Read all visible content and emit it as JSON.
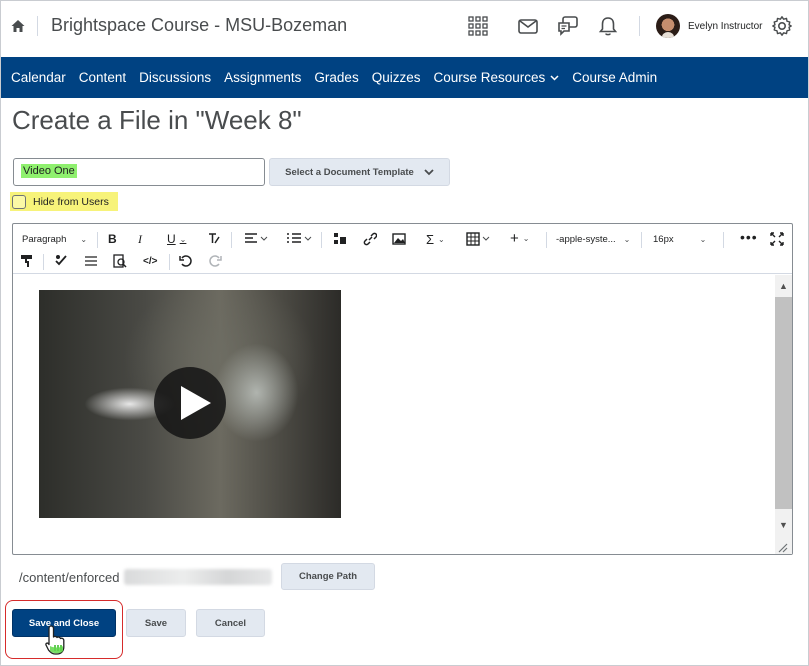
{
  "header": {
    "course_title": "Brightspace Course - MSU-Bozeman",
    "user_name": "Evelyn Instructor",
    "icons": [
      "home-icon",
      "waffle-grid-icon",
      "mail-icon",
      "chat-icon",
      "bell-icon",
      "gear-icon"
    ]
  },
  "nav": {
    "items": [
      {
        "label": "Calendar"
      },
      {
        "label": "Content"
      },
      {
        "label": "Discussions"
      },
      {
        "label": "Assignments"
      },
      {
        "label": "Grades"
      },
      {
        "label": "Quizzes"
      },
      {
        "label": "Course Resources",
        "has_dropdown": true
      },
      {
        "label": "Course Admin"
      }
    ]
  },
  "page": {
    "title": "Create a File in \"Week 8\"",
    "file_name_value": "Video One",
    "template_button": "Select a Document Template",
    "hide_label": "Hide from Users",
    "hide_checked": false
  },
  "toolbar": {
    "block_format": "Paragraph",
    "font_family": "-apple-syste...",
    "font_size": "16px"
  },
  "path": {
    "prefix": "/content/enforced",
    "change_path_label": "Change Path"
  },
  "actions": {
    "save_close": "Save and Close",
    "save": "Save",
    "cancel": "Cancel"
  },
  "colors": {
    "nav_bg": "#004282",
    "primary_button": "#004282",
    "name_highlight": "#8ff06e",
    "hide_highlight": "#f7f37a",
    "focus_ring": "#d62b2b"
  }
}
